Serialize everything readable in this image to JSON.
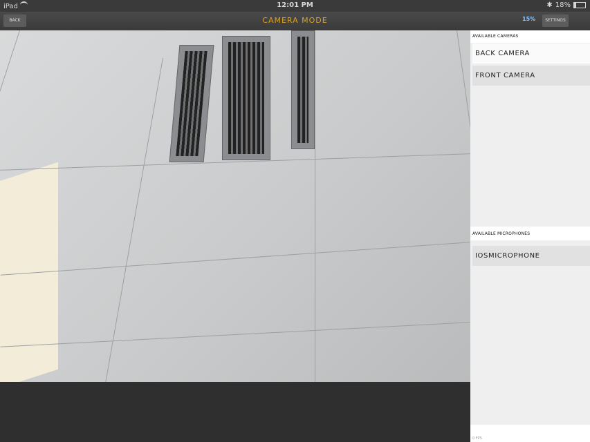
{
  "status": {
    "device": "iPad",
    "time": "12:01 PM",
    "battery": "18%"
  },
  "nav": {
    "back": "BACK",
    "title": "CAMERA MODE",
    "settings": "SETTINGS",
    "stats_icon": "15%"
  },
  "cameras": {
    "label": "AVAILABLE CAMERAS",
    "items": [
      "BACK CAMERA",
      "FRONT CAMERA"
    ]
  },
  "microphones": {
    "label": "AVAILABLE MICROPHONES",
    "items": [
      "IOSMICROPHONE"
    ]
  },
  "footer": {
    "fps": "0 FPS"
  },
  "icons": [
    "wifi-icon",
    "bluetooth-icon",
    "battery-icon",
    "stats-icon"
  ]
}
